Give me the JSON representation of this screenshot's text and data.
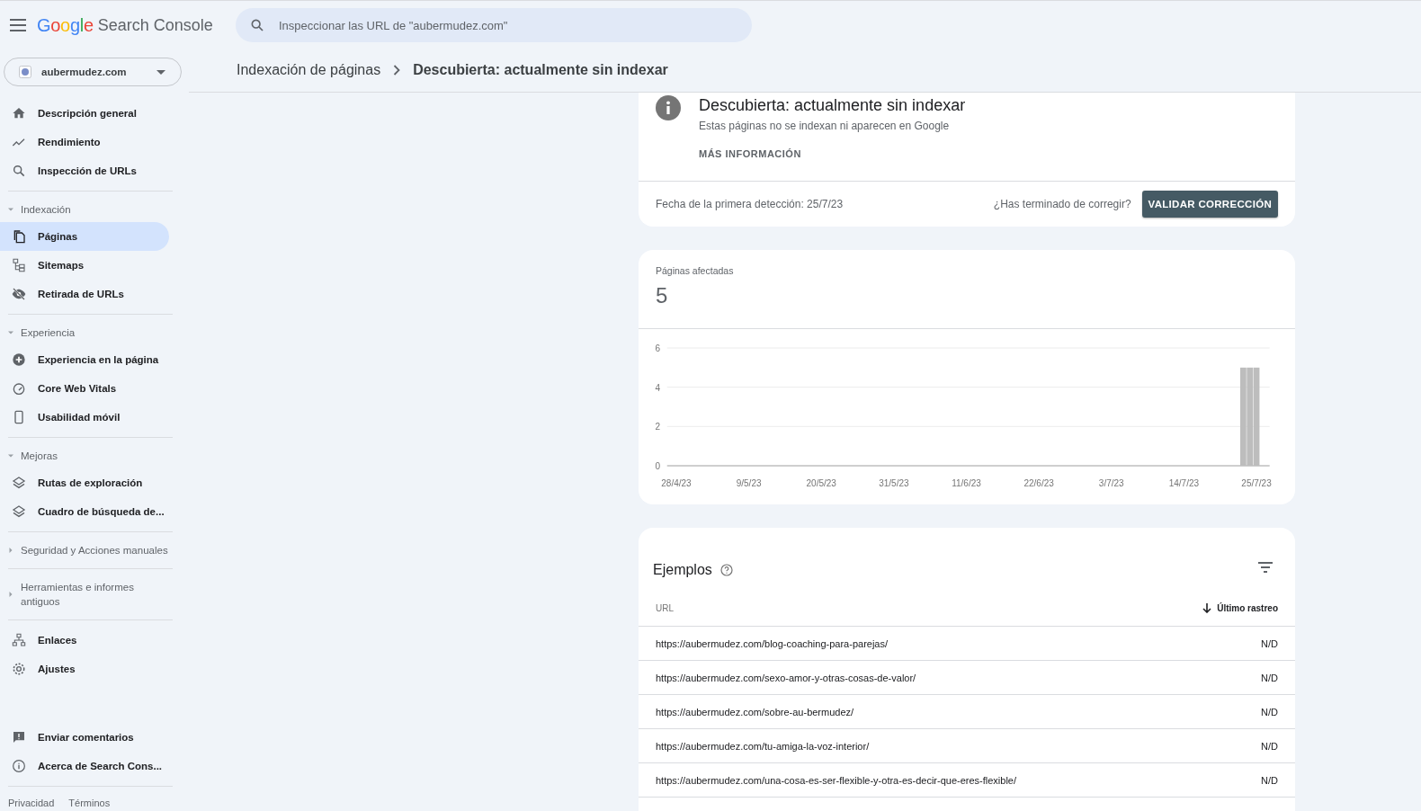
{
  "header": {
    "logo_word": "Google",
    "product": "Search Console",
    "search": {
      "placeholder": "Inspeccionar las URL de \"aubermudez.com\""
    }
  },
  "sidebar": {
    "property": "aubermudez.com",
    "groups": [
      {
        "items": [
          {
            "label": "Descripción general",
            "selected": false
          },
          {
            "label": "Rendimiento",
            "selected": false
          },
          {
            "label": "Inspección de URLs",
            "selected": false
          }
        ]
      },
      {
        "header": {
          "label": "Indexación",
          "expanded": true
        },
        "items": [
          {
            "label": "Páginas",
            "selected": true
          },
          {
            "label": "Sitemaps",
            "selected": false
          },
          {
            "label": "Retirada de URLs",
            "selected": false
          }
        ]
      },
      {
        "header": {
          "label": "Experiencia",
          "expanded": true
        },
        "items": [
          {
            "label": "Experiencia en la página",
            "selected": false
          },
          {
            "label": "Core Web Vitals",
            "selected": false
          },
          {
            "label": "Usabilidad móvil",
            "selected": false
          }
        ]
      },
      {
        "header": {
          "label": "Mejoras",
          "expanded": true
        },
        "items": [
          {
            "label": "Rutas de exploración",
            "selected": false
          },
          {
            "label": "Cuadro de búsqueda de...",
            "selected": false
          }
        ]
      },
      {
        "header": {
          "label": "Seguridad y Acciones manuales",
          "expanded": false
        }
      },
      {
        "header": {
          "label": "Herramientas e informes antiguos",
          "expanded": false
        }
      },
      {
        "items": [
          {
            "label": "Enlaces",
            "selected": false
          },
          {
            "label": "Ajustes",
            "selected": false
          }
        ]
      },
      {
        "items": [
          {
            "label": "Enviar comentarios",
            "selected": false
          },
          {
            "label": "Acerca de Search Cons...",
            "selected": false
          }
        ]
      }
    ],
    "footer_links": [
      "Privacidad",
      "Términos"
    ]
  },
  "breadcrumb": [
    "Indexación de páginas",
    "Descubierta: actualmente sin indexar"
  ],
  "issue": {
    "title": "Descubierta: actualmente sin indexar",
    "description": "Estas páginas no se indexan ni aparecen en Google",
    "more_link": "MÁS INFORMACIÓN",
    "first_detected": "Fecha de la primera detección: 25/7/23",
    "question": "¿Has terminado de corregir?",
    "button": "VALIDAR CORRECCIÓN"
  },
  "affected": {
    "label": "Páginas afectadas",
    "count": "5",
    "chart_data": {
      "type": "bar",
      "ylim": [
        0,
        6
      ],
      "yticks": [
        0,
        2,
        4,
        6
      ],
      "categories": [
        "28/4/23",
        null,
        null,
        null,
        null,
        null,
        null,
        null,
        null,
        null,
        null,
        "9/5/23",
        null,
        null,
        null,
        null,
        null,
        null,
        null,
        null,
        null,
        null,
        "20/5/23",
        null,
        null,
        null,
        null,
        null,
        null,
        null,
        null,
        null,
        null,
        "31/5/23",
        null,
        null,
        null,
        null,
        null,
        null,
        null,
        null,
        null,
        null,
        "11/6/23",
        null,
        null,
        null,
        null,
        null,
        null,
        null,
        null,
        null,
        null,
        "22/6/23",
        null,
        null,
        null,
        null,
        null,
        null,
        null,
        null,
        null,
        null,
        "3/7/23",
        null,
        null,
        null,
        null,
        null,
        null,
        null,
        null,
        null,
        null,
        "14/7/23",
        null,
        null,
        null,
        null,
        null,
        null,
        null,
        null,
        null,
        null,
        "25/7/23",
        null
      ],
      "values": [
        0,
        0,
        0,
        0,
        0,
        0,
        0,
        0,
        0,
        0,
        0,
        0,
        0,
        0,
        0,
        0,
        0,
        0,
        0,
        0,
        0,
        0,
        0,
        0,
        0,
        0,
        0,
        0,
        0,
        0,
        0,
        0,
        0,
        0,
        0,
        0,
        0,
        0,
        0,
        0,
        0,
        0,
        0,
        0,
        0,
        0,
        0,
        0,
        0,
        0,
        0,
        0,
        0,
        0,
        0,
        0,
        0,
        0,
        0,
        0,
        0,
        0,
        0,
        0,
        0,
        0,
        0,
        0,
        0,
        0,
        0,
        0,
        0,
        0,
        0,
        0,
        0,
        0,
        0,
        0,
        0,
        0,
        0,
        0,
        0,
        0,
        5,
        5,
        5,
        0
      ]
    }
  },
  "examples": {
    "title": "Ejemplos",
    "columns": [
      "URL",
      "Último rastreo"
    ],
    "rows": [
      [
        "https://aubermudez.com/blog-coaching-para-parejas/",
        "N/D"
      ],
      [
        "https://aubermudez.com/sexo-amor-y-otras-cosas-de-valor/",
        "N/D"
      ],
      [
        "https://aubermudez.com/sobre-au-bermudez/",
        "N/D"
      ],
      [
        "https://aubermudez.com/tu-amiga-la-voz-interior/",
        "N/D"
      ],
      [
        "https://aubermudez.com/una-cosa-es-ser-flexible-y-otra-es-decir-que-eres-flexible/",
        "N/D"
      ]
    ]
  }
}
